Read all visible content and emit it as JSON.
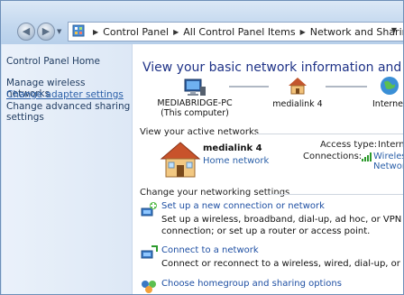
{
  "address_bar": {
    "crumbs": [
      "Control Panel",
      "All Control Panel Items",
      "Network and Sharing Center"
    ]
  },
  "left_pane": {
    "home": "Control Panel Home",
    "links": [
      "Manage wireless networks",
      "Change adapter settings",
      "Change advanced sharing settings"
    ]
  },
  "main": {
    "title": "View your basic network information and set up connections",
    "map": {
      "computer_name": "MEDIABRIDGE-PC",
      "computer_sub": "(This computer)",
      "network": "medialink 4",
      "internet": "Internet"
    },
    "active_networks": {
      "header": "View your active networks",
      "name": "medialink 4",
      "type": "Home network",
      "access_type_label": "Access type:",
      "access_type_value": "Internet",
      "connections_label": "Connections:",
      "connections_value": "Wireless Network Connection"
    },
    "settings": {
      "header": "Change your networking settings",
      "tasks": [
        {
          "link": "Set up a new connection or network",
          "desc": "Set up a wireless, broadband, dial-up, ad hoc, or VPN connection; or set up a router or access point."
        },
        {
          "link": "Connect to a network",
          "desc": "Connect or reconnect to a wireless, wired, dial-up, or VPN network connection."
        },
        {
          "link": "Choose homegroup and sharing options",
          "desc": ""
        }
      ]
    }
  },
  "colors": {
    "link": "#2a5fa8",
    "title": "#1e3287"
  }
}
